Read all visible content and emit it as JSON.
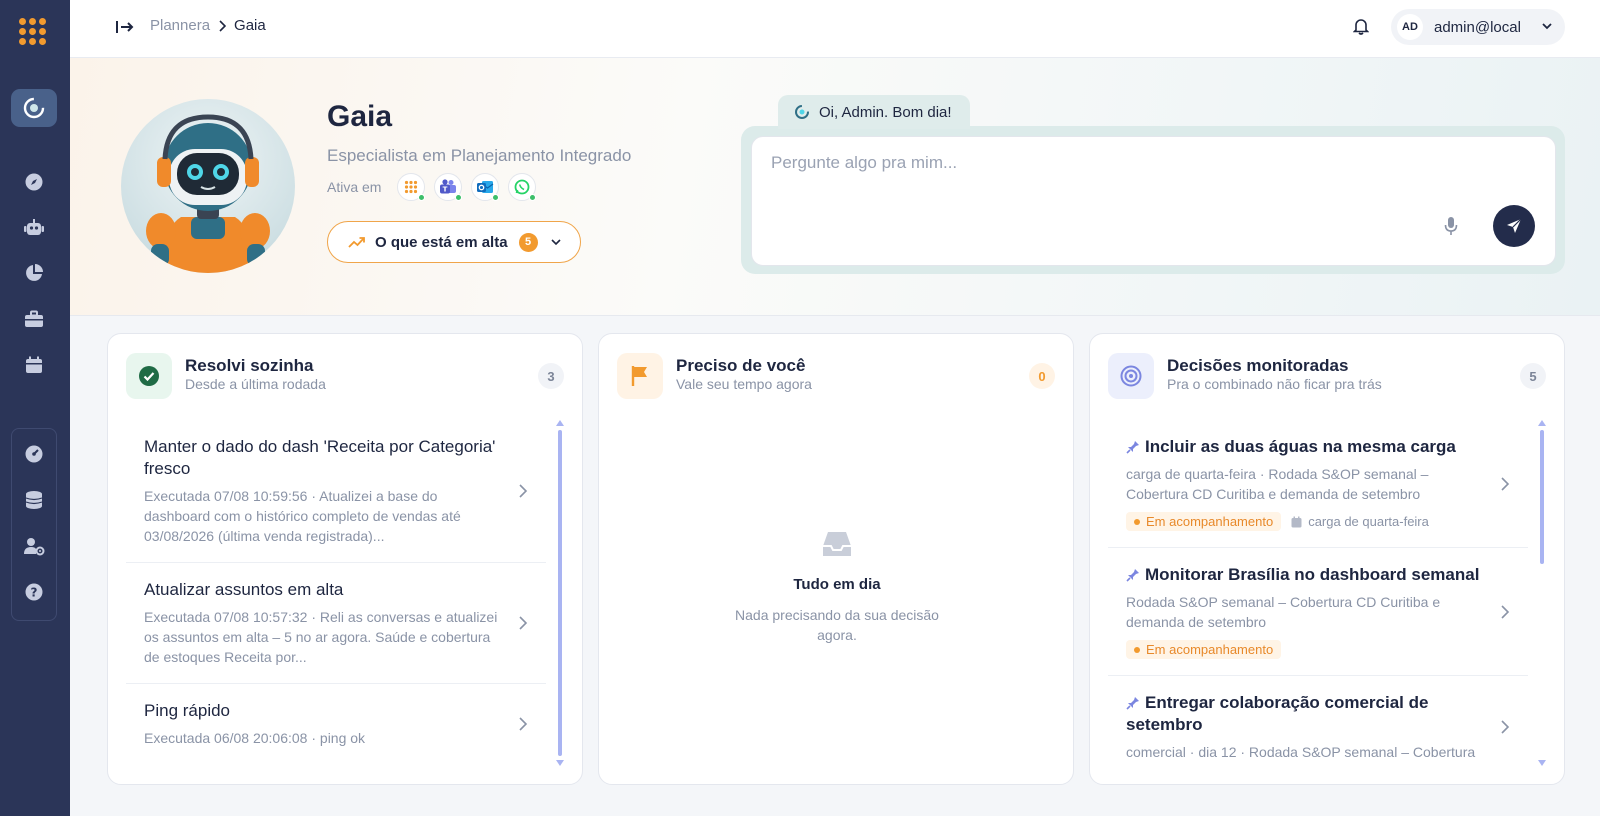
{
  "breadcrumb": {
    "parent": "Plannera",
    "current": "Gaia"
  },
  "user": {
    "initials": "AD",
    "name": "admin@local"
  },
  "agent": {
    "name": "Gaia",
    "role": "Especialista em Planejamento Integrado",
    "active_label": "Ativa em",
    "channels": [
      "plannera-icon",
      "teams-icon",
      "outlook-icon",
      "whatsapp-icon"
    ]
  },
  "trending": {
    "label": "O que está em alta",
    "count": "5"
  },
  "chat": {
    "greeting": "Oi, Admin. Bom dia!",
    "placeholder": "Pergunte algo pra mim..."
  },
  "cards": {
    "resolved": {
      "title": "Resolvi sozinha",
      "subtitle": "Desde a última rodada",
      "count": "3",
      "items": [
        {
          "title": "Manter o dado do dash 'Receita por Categoria' fresco",
          "desc": "Executada 07/08 10:59:56 · Atualizei a base do dashboard com o histórico completo de vendas até 03/08/2026 (última venda registrada)..."
        },
        {
          "title": "Atualizar assuntos em alta",
          "desc": "Executada 07/08 10:57:32 · Reli as conversas e atualizei os assuntos em alta – 5 no ar agora. Saúde e cobertura de estoques Receita por..."
        },
        {
          "title": "Ping rápido",
          "desc": "Executada 06/08 20:06:08 · ping ok"
        }
      ]
    },
    "needs_you": {
      "title": "Preciso de você",
      "subtitle": "Vale seu tempo agora",
      "count": "0",
      "empty_title": "Tudo em dia",
      "empty_desc": "Nada precisando da sua decisão agora."
    },
    "decisions": {
      "title": "Decisões monitoradas",
      "subtitle": "Pra o combinado não ficar pra trás",
      "count": "5",
      "items": [
        {
          "title": "Incluir as duas águas na mesma carga",
          "desc": "carga de quarta-feira · Rodada S&OP semanal – Cobertura CD Curitiba e demanda de setembro",
          "status": "Em acompanhamento",
          "meta": "carga de quarta-feira"
        },
        {
          "title": "Monitorar Brasília no dashboard semanal",
          "desc": "Rodada S&OP semanal – Cobertura CD Curitiba e demanda de setembro",
          "status": "Em acompanhamento",
          "meta": ""
        },
        {
          "title": "Entregar colaboração comercial de setembro",
          "desc": "comercial · dia 12 · Rodada S&OP semanal – Cobertura",
          "status": "",
          "meta": ""
        }
      ]
    }
  },
  "colors": {
    "sidebar": "#2b3558",
    "accent": "#f29a2e",
    "success": "#1f8a4c",
    "primary": "#232c4b"
  }
}
